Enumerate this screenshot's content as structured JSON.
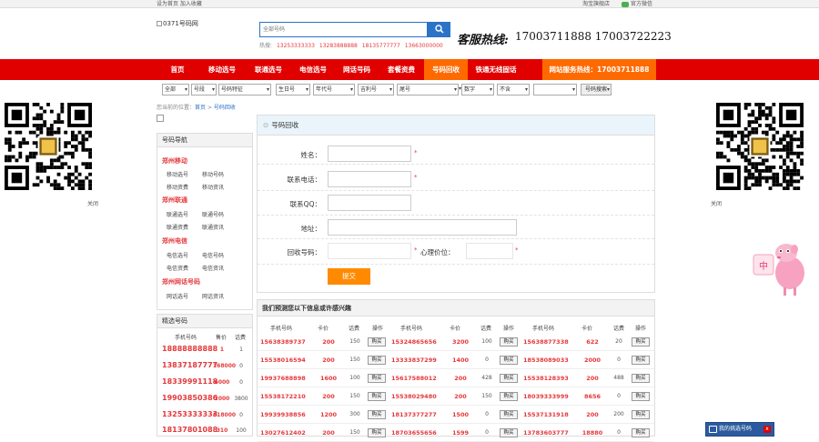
{
  "topbar": {
    "left": "设为首页  加入收藏",
    "taobao": "淘宝旗舰店",
    "wechat": "官方微信"
  },
  "header": {
    "logo_alt": "0371号码网",
    "search_placeholder": "全部号码",
    "hotline_label": "客服热线:",
    "hotline_numbers": "17003711888 17003722223",
    "hot_prefix": "热搜:",
    "hot_numbers": [
      "13253333333",
      "13283888888",
      "18135777777",
      "13663000000"
    ]
  },
  "nav": {
    "items": [
      "首页",
      "移动选号",
      "联通选号",
      "电信选号",
      "网话号码",
      "套餐资费",
      "号码回收",
      "铁通无线固话"
    ],
    "active_index": 6,
    "service_hotline": "网站服务热线：17003711888"
  },
  "filters": [
    "全部",
    "号段",
    "号码特征",
    "生日号",
    "年代号",
    "吉利号",
    "尾号",
    "",
    "数字",
    "不含"
  ],
  "filter_button": "号码搜索",
  "breadcrumb": {
    "prefix": "您当前的位置：",
    "home": "首页",
    "sep": ">",
    "current": "号码回收"
  },
  "sidebar": {
    "title": "号码导航",
    "groups": [
      {
        "name": "郑州移动",
        "links": [
          "移动选号",
          "移动号码",
          "移动资费",
          "移动资讯"
        ]
      },
      {
        "name": "郑州联通",
        "links": [
          "联通选号",
          "联通号码",
          "联通资费",
          "联通资讯"
        ]
      },
      {
        "name": "郑州电信",
        "links": [
          "电信选号",
          "电信号码",
          "电信资费",
          "电信资讯"
        ]
      },
      {
        "name": "郑州网话号码",
        "links": [
          "网话选号",
          "网话资讯"
        ]
      }
    ]
  },
  "picked": {
    "title": "精选号码",
    "headers": [
      "手机号码",
      "售价",
      "话费"
    ],
    "rows": [
      {
        "pre": "18888888888",
        "price": "1",
        "fee": "1"
      },
      {
        "pre": "13837187777",
        "price": "168000",
        "fee": "0"
      },
      {
        "pre": "18339991118",
        "price": "6000",
        "fee": "0"
      },
      {
        "pre": "19903850386",
        "price": "2000",
        "fee": "3800"
      },
      {
        "pre": "13253333333",
        "price": "618000",
        "fee": "0"
      },
      {
        "pre": "18137801088",
        "price": "310",
        "fee": "100"
      }
    ]
  },
  "form": {
    "title": "号码回收",
    "name_label": "姓名：",
    "phone_label": "联系电话：",
    "qq_label": "联系QQ：",
    "address_label": "地址：",
    "recycle_label": "回收号码：",
    "price_label": "心理价位：",
    "required_mark": "*",
    "submit": "提交"
  },
  "price_table": {
    "title": "我们预测您以下信息或许感兴趣",
    "headers": [
      "手机号码",
      "卡价",
      "话费",
      "操作"
    ],
    "buy_label": "购买",
    "rows": [
      [
        {
          "num": "15638389737",
          "price": "200",
          "fee": "150"
        },
        {
          "num": "15324865656",
          "price": "3200",
          "fee": "100"
        },
        {
          "num": "15638877338",
          "price": "622",
          "fee": "20"
        }
      ],
      [
        {
          "num": "15538016594",
          "price": "200",
          "fee": "150"
        },
        {
          "num": "13333837299",
          "price": "1400",
          "fee": "0"
        },
        {
          "num": "18538089033",
          "price": "2000",
          "fee": "0"
        }
      ],
      [
        {
          "num": "19937688898",
          "price": "1600",
          "fee": "100"
        },
        {
          "num": "15617588012",
          "price": "200",
          "fee": "428"
        },
        {
          "num": "15538128393",
          "price": "200",
          "fee": "488"
        }
      ],
      [
        {
          "num": "15538172210",
          "price": "200",
          "fee": "150"
        },
        {
          "num": "15538029480",
          "price": "200",
          "fee": "150"
        },
        {
          "num": "18039333999",
          "price": "8656",
          "fee": "0"
        }
      ],
      [
        {
          "num": "19939938856",
          "price": "1200",
          "fee": "300"
        },
        {
          "num": "18137377277",
          "price": "1500",
          "fee": "0"
        },
        {
          "num": "15537131918",
          "price": "200",
          "fee": "200"
        }
      ],
      [
        {
          "num": "13027612402",
          "price": "200",
          "fee": "150"
        },
        {
          "num": "18703655656",
          "price": "1599",
          "fee": "0"
        },
        {
          "num": "13783603777",
          "price": "18880",
          "fee": "0"
        }
      ]
    ]
  },
  "qr": {
    "close": "关闭"
  },
  "float_bar": {
    "label": "我的挑选号码",
    "close": "x"
  },
  "pig_badge": "中"
}
